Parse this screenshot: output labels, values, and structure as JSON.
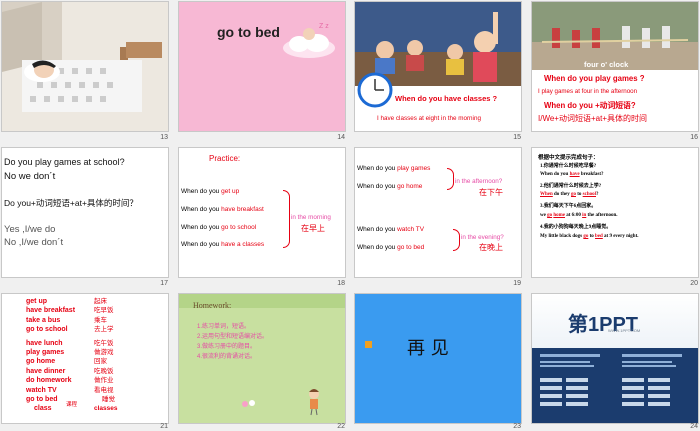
{
  "slides": [
    {
      "num": "13"
    },
    {
      "num": "14",
      "title": "go to bed"
    },
    {
      "num": "15",
      "question": "When do you have classes ?",
      "answer": "I have classes at eight in the morning"
    },
    {
      "num": "16",
      "time_label": "four  o' clock",
      "line1": "When do you play games ?",
      "line2": "I play games at four in the afternoon",
      "line3": "When do you +动词短语?",
      "line4": "I/We+动词短语+at+具体的时间"
    },
    {
      "num": "17",
      "l1": "Do you play games at school?",
      "l2": "No we don´t",
      "l3": "Do you+动词短语+at+具体的时间？",
      "l4": "Yes ,I/we do",
      "l5": "No ,I/we don´t"
    },
    {
      "num": "18",
      "title": "Practice:",
      "rows": [
        {
          "p": "When  do you ",
          "v": "get up"
        },
        {
          "p": "When do you ",
          "v": "have breakfast"
        },
        {
          "p": "When  do you ",
          "v": "go to school"
        },
        {
          "p": "When   do you ",
          "v": "have a classes"
        }
      ],
      "side": "in the morning",
      "side_cn": "在早上"
    },
    {
      "num": "19",
      "rows": [
        {
          "p": "When  do you ",
          "v": "play games"
        },
        {
          "p": "When  do you ",
          "v": "go home"
        },
        {
          "p": "When  do you ",
          "v": "watch TV"
        },
        {
          "p": "When  do you ",
          "v": "go to bed"
        }
      ],
      "side1": "in the afternoon?",
      "side1_cn": "在下午",
      "side2": "in the evening?",
      "side2_cn": "在晚上"
    },
    {
      "num": "20",
      "title": "根据中文提示完成句子：",
      "lines": [
        "1.你通常什么时候吃早餐?",
        "When do you ___ breakfast?",
        "2.他们通常什么时候去上学?",
        "___ do they ___ to ___ school?",
        "3.我们每天下午6点回家。",
        "we ___ ___ at 6:00 ___ the afternoon.",
        "4.我的小狗狗每天晚上9点睡觉。",
        "My little black dogs ___ to ___ at 9 every night."
      ],
      "fills": [
        "have",
        "When",
        "go",
        "go",
        "home",
        "in",
        "go",
        "bed"
      ]
    },
    {
      "num": "21",
      "en": [
        "get up",
        "have breakfast",
        "take a bus",
        "go to school",
        "have lunch",
        "play games",
        "go home",
        "have dinner",
        "do  homework",
        "watch TV",
        "go to bed",
        "class"
      ],
      "cn": [
        "起床",
        "吃早饭",
        "乘车",
        "去上学",
        "吃午饭",
        "做游戏",
        "回家",
        "吃晚饭",
        "做作业",
        "看电视",
        "睡觉",
        "classes"
      ],
      "class_cn": "课程"
    },
    {
      "num": "22",
      "title": "Homework:",
      "items": [
        "1.练习单词，短语。",
        "2.运用句型和短语编对话。",
        "3.做练习册中的题目。",
        "4.很流利的背诵对话。"
      ]
    },
    {
      "num": "23",
      "text": "再  见"
    },
    {
      "num": "24",
      "logo_main": "第1PPT",
      "logo_sub": "WWW.1PPT.COM"
    }
  ],
  "colors": {
    "pink": "#f7b8d4",
    "blue_bg": "#3a9bf0",
    "green_bg": "#c8e0a0",
    "navy": "#1b3c6e"
  }
}
